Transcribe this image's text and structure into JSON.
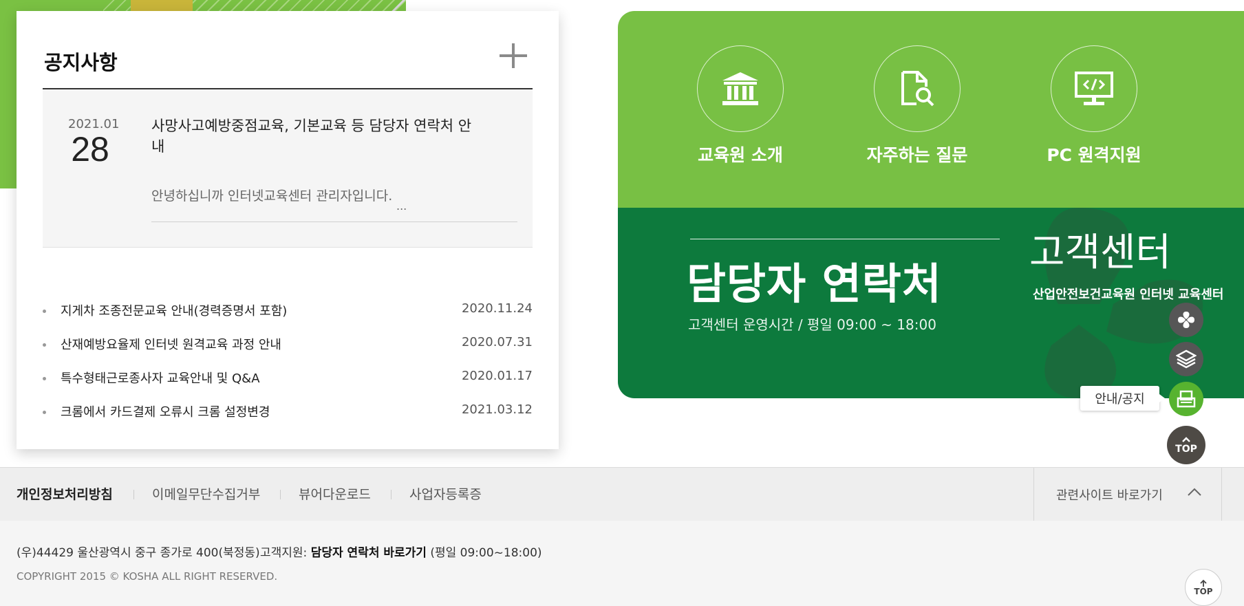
{
  "notice": {
    "title": "공지사항",
    "more_icon": "plus-icon",
    "featured": {
      "year_month": "2021.01",
      "day": "28",
      "title": "사망사고예방중점교육, 기본교육 등 담당자 연락처 안내",
      "excerpt": "안녕하십니까 인터넷교육센터 관리자입니다.",
      "ellipsis": "..."
    },
    "items": [
      {
        "title": "지게차 조종전문교육 안내(경력증명서 포함)",
        "date": "2020.11.24"
      },
      {
        "title": "산재예방요율제 인터넷 원격교육 과정 안내",
        "date": "2020.07.31"
      },
      {
        "title": "특수형태근로종사자 교육안내 및 Q&A",
        "date": "2020.01.17"
      },
      {
        "title": "크롬에서 카드결제 오류시 크롬 설정변경",
        "date": "2021.03.12"
      }
    ]
  },
  "quick_links": [
    {
      "label": "교육원 소개",
      "icon": "institution-icon"
    },
    {
      "label": "자주하는 질문",
      "icon": "document-search-icon"
    },
    {
      "label": "PC 원격지원",
      "icon": "monitor-code-icon"
    }
  ],
  "customer_center": {
    "contact_title": "담당자 연락처",
    "hours": "고객센터 운영시간 / 평일 09:00 ~ 18:00",
    "title": "고객센터",
    "subtitle": "산업안전보건교육원 인터넷 교육센터"
  },
  "floating_menu": {
    "tooltip": "안내/공지",
    "buttons": [
      "pinwheel-icon",
      "layers-icon",
      "notice-board-icon"
    ],
    "top_label": "TOP"
  },
  "footer": {
    "links": [
      "개인정보처리방침",
      "이메일무단수집거부",
      "뷰어다운로드",
      "사업자등록증"
    ],
    "related_sites": "관련사이트 바로가기",
    "address": "(우)44429 울산광역시 중구 종가로 400(북정동)",
    "support_prefix": "고객지원:",
    "support_link": "담당자 연락처 바로가기",
    "support_suffix": "(평일 09:00~18:00)",
    "copyright": "COPYRIGHT 2015 © KOSHA ALL RIGHT RESERVED.",
    "top_label": "TOP"
  },
  "colors": {
    "light_green": "#78c044",
    "dark_green": "#0d7a3d",
    "active_green": "#57b32f"
  }
}
